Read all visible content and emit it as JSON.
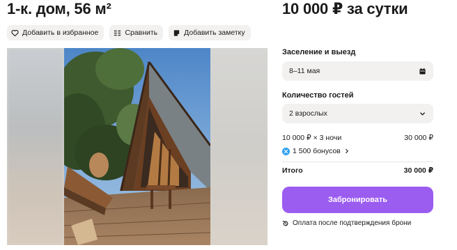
{
  "listing": {
    "title": "1-к. дом, 56 м²",
    "price": "10 000 ₽ за сутки"
  },
  "actions": {
    "favorite_label": "Добавить в избранное",
    "compare_label": "Сравнить",
    "note_label": "Добавить заметку"
  },
  "booking": {
    "dates_label": "Заселение и выезд",
    "dates_value": "8–11 мая",
    "guests_label": "Количество гостей",
    "guests_value": "2 взрослых",
    "calc_label": "10 000 ₽ × 3 ночи",
    "calc_value": "30 000 ₽",
    "bonus_label": "1 500 бонусов",
    "total_label": "Итого",
    "total_value": "30 000 ₽",
    "book_button": "Забронировать",
    "payment_note": "Оплата после подтверждения брони"
  },
  "colors": {
    "accent": "#9b5cf0",
    "field_bg": "#f2f1f0",
    "bonus": "#2ea1f0"
  },
  "icons": [
    "heart-icon",
    "compare-icon",
    "note-icon",
    "calendar-icon",
    "chevron-down-icon",
    "bonus-icon",
    "chevron-right-icon",
    "refund-icon"
  ]
}
